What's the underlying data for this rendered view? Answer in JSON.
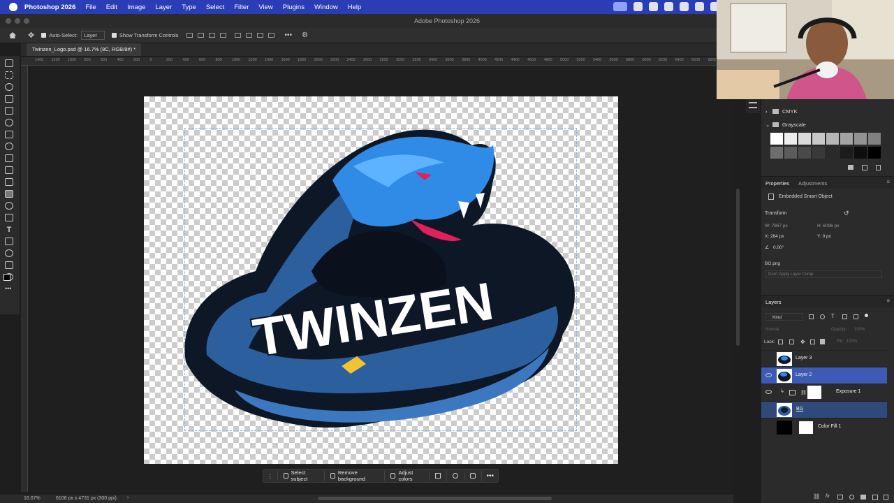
{
  "menubar": {
    "app_name": "Photoshop 2026",
    "items": [
      "File",
      "Edit",
      "Image",
      "Layer",
      "Type",
      "Select",
      "Filter",
      "View",
      "Plugins",
      "Window",
      "Help"
    ]
  },
  "window": {
    "title": "Adobe Photoshop 2026"
  },
  "options_bar": {
    "auto_select_label": "Auto-Select:",
    "auto_select_value": "Layer",
    "show_transform_label": "Show Transform Controls"
  },
  "document": {
    "tab_title": "Twinzen_Logo.psd @ 16.7% (8C, RGB/8#) *",
    "artwork_text": "TWINZEN"
  },
  "ruler_top_labels": [
    "1400",
    "1200",
    "1000",
    "800",
    "600",
    "400",
    "200",
    "0",
    "200",
    "400",
    "600",
    "800",
    "1000",
    "1200",
    "1400",
    "1600",
    "1800",
    "2000",
    "2200",
    "2400",
    "2600",
    "2800",
    "3000",
    "3200",
    "3400",
    "3600",
    "3800",
    "4000",
    "4200",
    "4400",
    "4600",
    "4800",
    "5000",
    "5200",
    "5400",
    "5600",
    "5800",
    "6000",
    "6200",
    "6400",
    "6600",
    "6800",
    "7000"
  ],
  "contextual_taskbar": {
    "select_subject": "Select subject",
    "remove_background": "Remove background",
    "adjust_colors": "Adjust colors"
  },
  "status_bar": {
    "zoom": "16.67%",
    "doc_info": "6106 px x 4731 px (300 ppi)"
  },
  "swatches_panel": {
    "groups": [
      {
        "name": "CMYK",
        "expanded": false
      },
      {
        "name": "Grayscale",
        "expanded": true
      }
    ],
    "grays_row1": [
      "#ffffff",
      "#ededed",
      "#dadada",
      "#c8c8c8",
      "#b6b6b6",
      "#a4a4a4",
      "#929292",
      "#808080"
    ],
    "grays_row2": [
      "#6e6e6e",
      "#5c5c5c",
      "#4a4a4a",
      "#393939",
      "#2a2a2a",
      "#1c1c1c",
      "#0e0e0e",
      "#000000"
    ]
  },
  "properties_panel": {
    "tabs": [
      "Properties",
      "Adjustments"
    ],
    "object_type": "Embedded Smart Object",
    "transform_label": "Transform",
    "w": "W: 7867 px",
    "h": "H: 6096 px",
    "x": "X: 264 px",
    "y": "Y: 0 px",
    "angle": "0.00°",
    "source_file": "BG.png",
    "layer_comp": "Don't Apply Layer Comp"
  },
  "layers_panel": {
    "title": "Layers",
    "filter_kind": "Kind",
    "blend_mode": "Normal",
    "opacity_label": "Opacity:",
    "opacity_value": "100%",
    "lock_label": "Lock:",
    "fill_label": "Fill:",
    "fill_value": "100%",
    "layers": [
      {
        "name": "Layer 3",
        "visible": false,
        "selected": false
      },
      {
        "name": "Layer 2",
        "visible": true,
        "selected": true
      },
      {
        "name": "Exposure 1",
        "visible": true,
        "selected": false
      },
      {
        "name": "BG",
        "visible": false,
        "selected": true
      },
      {
        "name": "Color Fill 1",
        "visible": false,
        "selected": false
      }
    ]
  },
  "colors": {
    "menubar": "#2a3db5",
    "selection": "#3d5bb5",
    "logo_dark": "#0e1726",
    "logo_blue": "#2f8be6",
    "logo_mid": "#2b5f9e"
  }
}
